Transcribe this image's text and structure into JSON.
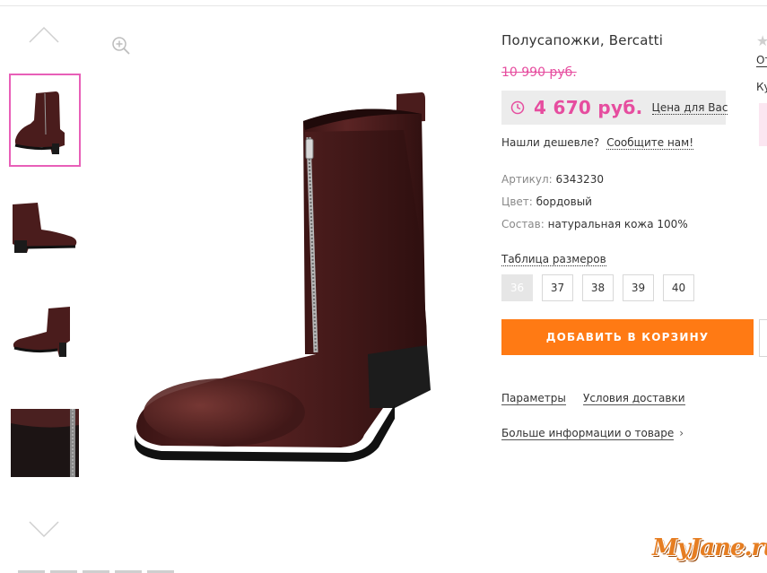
{
  "product": {
    "title": "Полусапожки, Bercatti",
    "old_price": "10 990 руб.",
    "new_price": "4 670 руб.",
    "your_price_label": "Цена для Вас",
    "found_cheaper_label": "Нашли дешевле?",
    "report_link": "Сообщите нам!",
    "attributes": [
      {
        "label": "Артикул:",
        "value": "6343230"
      },
      {
        "label": "Цвет:",
        "value": "бордовый"
      },
      {
        "label": "Состав:",
        "value": "натуральная кожа 100%"
      }
    ],
    "size_table_link": "Таблица размеров",
    "sizes": [
      {
        "label": "36",
        "available": false
      },
      {
        "label": "37",
        "available": true
      },
      {
        "label": "38",
        "available": true
      },
      {
        "label": "39",
        "available": true
      },
      {
        "label": "40",
        "available": true
      }
    ],
    "add_to_cart": "ДОБАВИТЬ В КОРЗИНУ",
    "links": {
      "params": "Параметры",
      "delivery": "Условия доставки",
      "more_info": "Больше информации о товаре"
    }
  },
  "gallery": {
    "thumbnails": [
      {
        "name": "thumb-front",
        "active": true
      },
      {
        "name": "thumb-side",
        "active": false
      },
      {
        "name": "thumb-angle",
        "active": false
      },
      {
        "name": "thumb-detail",
        "active": false
      }
    ],
    "icons": [
      "arrow-up-icon",
      "arrow-down-icon",
      "zoom-in-icon",
      "clock-icon"
    ]
  },
  "right_column": {
    "cut_text_1": "От",
    "cut_text_2": "Ку"
  },
  "watermark": "MyJane.ru",
  "colors": {
    "accent_pink": "#e64d9f",
    "button_orange": "#ff7a14",
    "price_box_bg": "#ececec",
    "thumb_border": "#e85fb8",
    "boot_leather": "#4a1c1c"
  }
}
